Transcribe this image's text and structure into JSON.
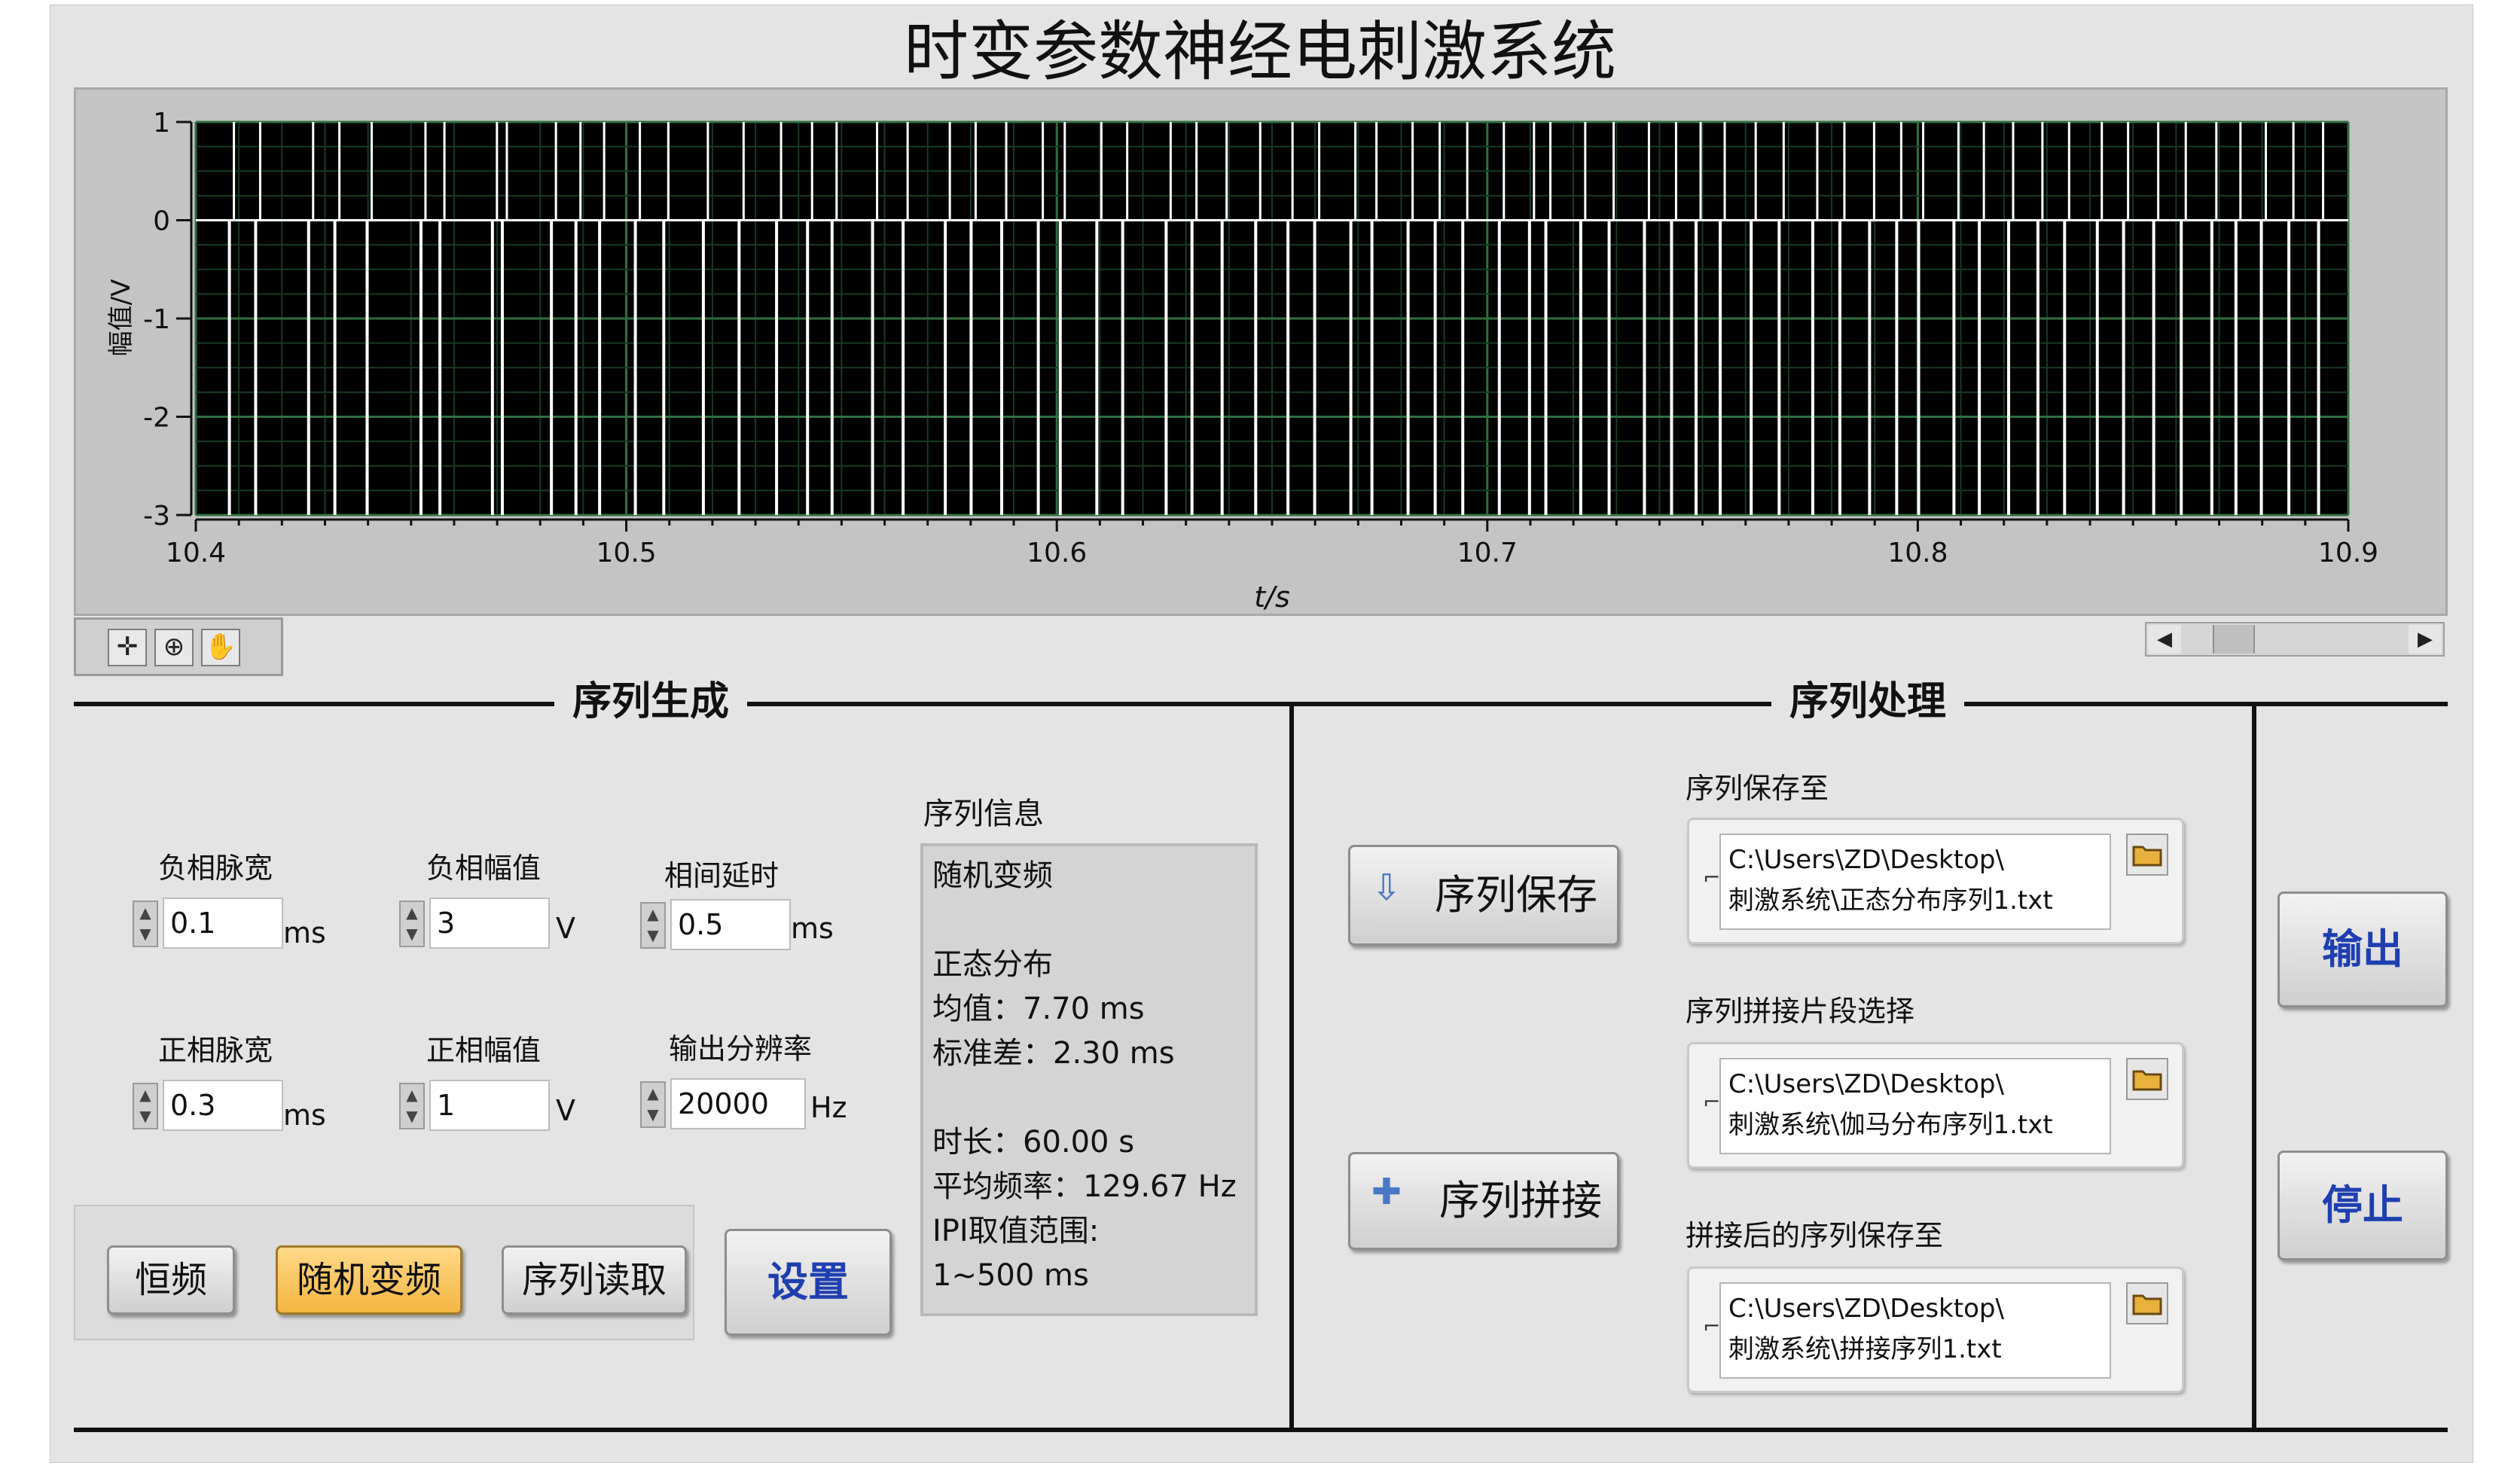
{
  "app": {
    "title": "时变参数神经电刺激系统"
  },
  "chart_data": {
    "type": "line",
    "title": "",
    "xlabel": "t/s",
    "ylabel": "幅值/V",
    "xlim": [
      10.4,
      10.9
    ],
    "ylim": [
      -3,
      1
    ],
    "x_ticks": [
      "10.4",
      "10.5",
      "10.6",
      "10.7",
      "10.8",
      "10.9"
    ],
    "y_ticks": [
      "1",
      "0",
      "-1",
      "-2",
      "-3"
    ],
    "grid": true,
    "series": [
      {
        "color": "#ffffff",
        "baseline": 0,
        "neg_amplitude": -3,
        "pos_amplitude": 1,
        "pulse_times": [
          10.4078,
          10.4139,
          10.4262,
          10.4323,
          10.4398,
          10.4523,
          10.4567,
          10.4689,
          10.4712,
          10.4826,
          10.4883,
          10.4938,
          10.5021,
          10.5087,
          10.5179,
          10.5262,
          10.5349,
          10.5421,
          10.5478,
          10.5572,
          10.5643,
          10.5741,
          10.5801,
          10.5872,
          10.5957,
          10.6008,
          10.6093,
          10.6153,
          10.6254,
          10.6314,
          10.6384,
          10.6462,
          10.6537,
          10.6599,
          10.6683,
          10.6732,
          10.6816,
          10.6879,
          10.6943,
          10.7028,
          10.7098,
          10.7136,
          10.7217,
          10.7283,
          10.7365,
          10.7428,
          10.7485,
          10.7541,
          10.7613,
          10.7678,
          10.7756,
          10.7819,
          10.7888,
          10.7951,
          10.8002,
          10.8084,
          10.8143,
          10.8211,
          10.8279,
          10.8341,
          10.8417,
          10.8478,
          10.8548,
          10.8612,
          10.8683,
          10.8739,
          10.8798,
          10.8862,
          10.8931
        ]
      }
    ]
  },
  "graph_palette": {
    "cursor_icon": "crosshair-icon",
    "zoom_icon": "zoom-icon",
    "pan_icon": "hand-pan-icon"
  },
  "scrollbar": {
    "left_arrow": "◀",
    "right_arrow": "▶",
    "position": 0.1
  },
  "generation": {
    "section_title": "序列生成",
    "neg_width": {
      "label": "负相脉宽",
      "value": "0.1",
      "unit": "ms"
    },
    "neg_amp": {
      "label": "负相幅值",
      "value": "3",
      "unit": "V"
    },
    "delay": {
      "label": "相间延时",
      "value": "0.5",
      "unit": "ms"
    },
    "pos_width": {
      "label": "正相脉宽",
      "value": "0.3",
      "unit": "ms"
    },
    "pos_amp": {
      "label": "正相幅值",
      "value": "1",
      "unit": "V"
    },
    "resolution": {
      "label": "输出分辨率",
      "value": "20000",
      "unit": "Hz"
    },
    "buttons": {
      "constant": "恒频",
      "random": "随机变频",
      "read": "序列读取",
      "settings": "设置"
    },
    "info_label": "序列信息",
    "info_lines": [
      "随机变频",
      "",
      "正态分布",
      "均值：7.70 ms",
      "标准差：2.30 ms",
      "",
      "时长：60.00 s",
      "平均频率：129.67 Hz",
      "IPI取值范围:",
      "1~500 ms"
    ]
  },
  "processing": {
    "section_title": "序列处理",
    "save_button": "序列保存",
    "concat_button": "序列拼接",
    "save_to": {
      "label": "序列保存至",
      "line1": "C:\\Users\\ZD\\Desktop\\",
      "line2": "刺激系统\\正态分布序列1.txt"
    },
    "segment": {
      "label": "序列拼接片段选择",
      "line1": "C:\\Users\\ZD\\Desktop\\",
      "line2": "刺激系统\\伽马分布序列1.txt"
    },
    "concat_save": {
      "label": "拼接后的序列保存至",
      "line1": "C:\\Users\\ZD\\Desktop\\",
      "line2": "刺激系统\\拼接序列1.txt"
    }
  },
  "controls": {
    "output": "输出",
    "stop": "停止"
  }
}
